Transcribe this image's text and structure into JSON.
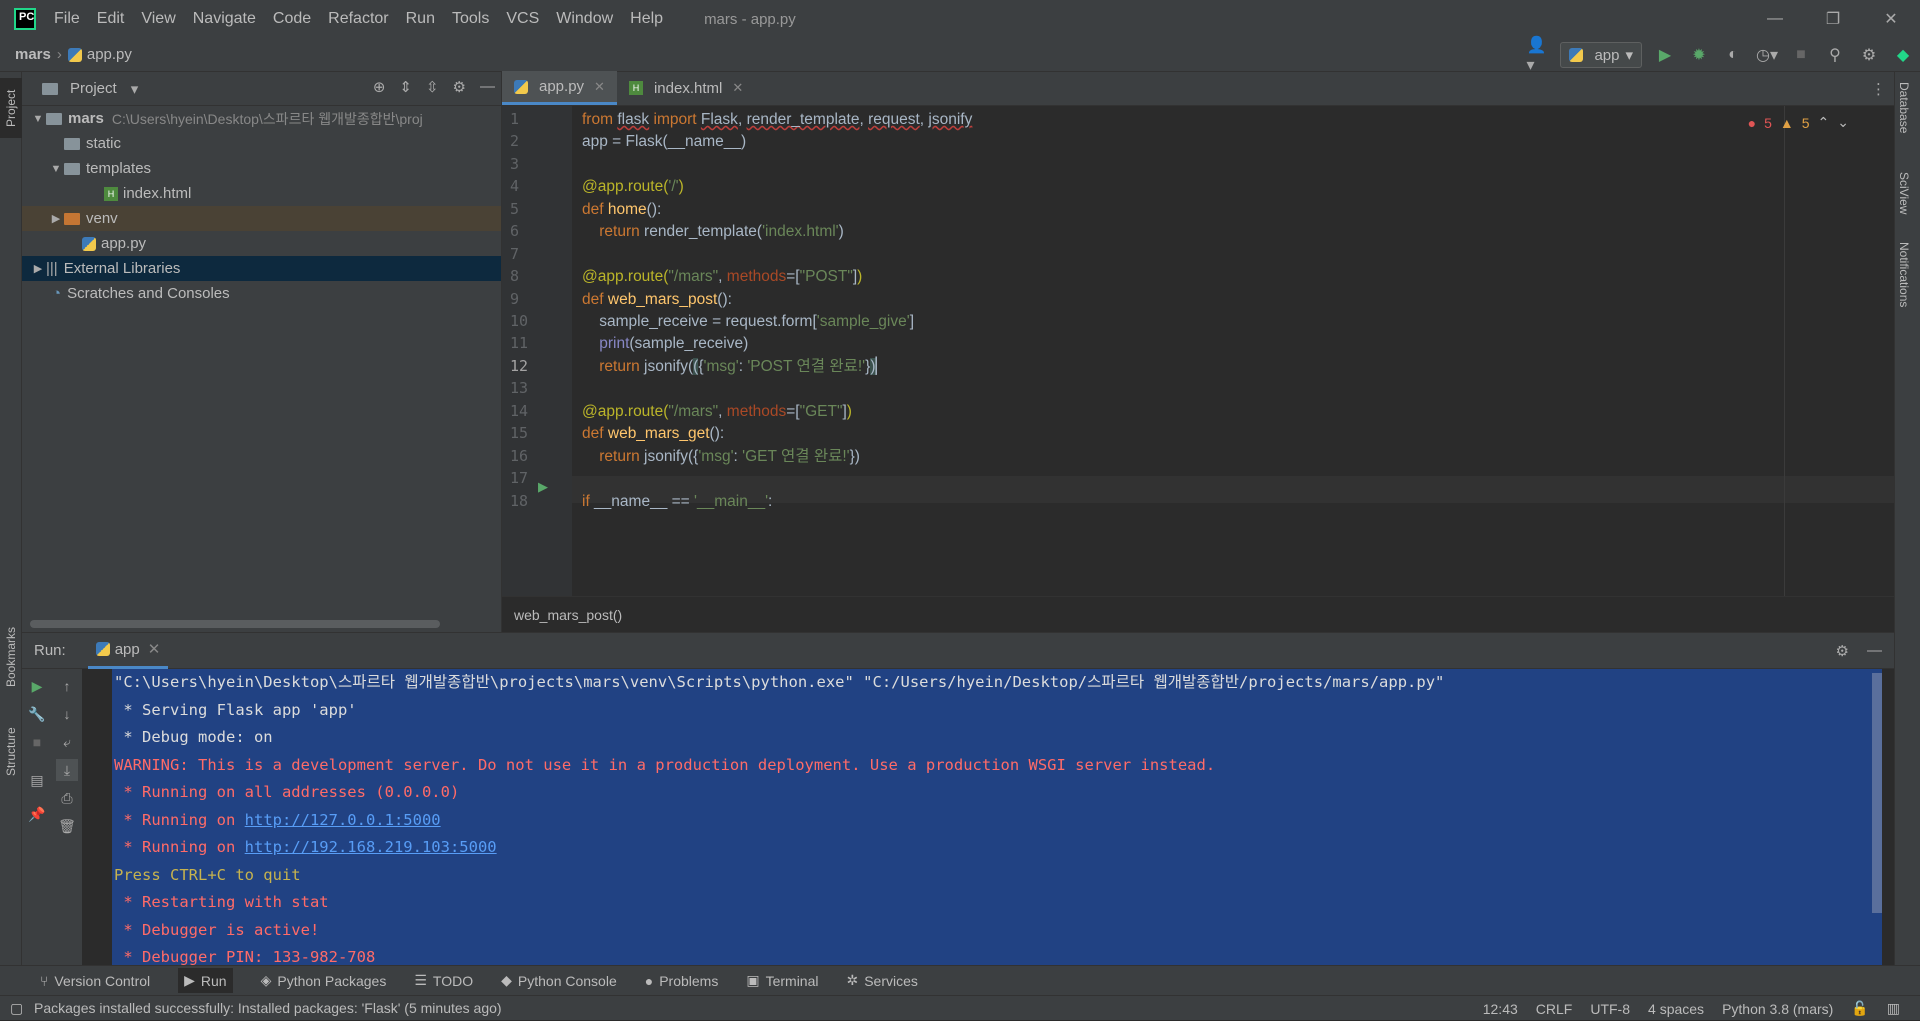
{
  "menu": [
    "File",
    "Edit",
    "View",
    "Navigate",
    "Code",
    "Refactor",
    "Run",
    "Tools",
    "VCS",
    "Window",
    "Help"
  ],
  "window_title": "mars - app.py",
  "breadcrumb": {
    "root": "mars",
    "file": "app.py"
  },
  "run_config": "app",
  "project": {
    "header": "Project",
    "root": "mars",
    "root_path": "C:\\Users\\hyein\\Desktop\\스파르타 웹개발종합반\\proj",
    "items": [
      "static",
      "templates",
      "index.html",
      "venv",
      "app.py",
      "External Libraries",
      "Scratches and Consoles"
    ]
  },
  "tabs": [
    "app.py",
    "index.html"
  ],
  "editor": {
    "error_count": "5",
    "warning_count": "5",
    "breadcrumb": "web_mars_post()"
  },
  "line_numbers": [
    "1",
    "2",
    "3",
    "4",
    "5",
    "6",
    "7",
    "8",
    "9",
    "10",
    "11",
    "12",
    "13",
    "14",
    "15",
    "16",
    "17",
    "18"
  ],
  "run": {
    "label": "Run:",
    "tab": "app"
  },
  "console": [
    "\"C:\\Users\\hyein\\Desktop\\스파르타 웹개발종합반\\projects\\mars\\venv\\Scripts\\python.exe\" \"C:/Users/hyein/Desktop/스파르타 웹개발종합반/projects/mars/app.py\"",
    " * Serving Flask app 'app'",
    " * Debug mode: on",
    "WARNING: This is a development server. Do not use it in a production deployment. Use a production WSGI server instead.",
    " * Running on all addresses (0.0.0.0)",
    " * Running on ",
    "http://127.0.0.1:5000",
    " * Running on ",
    "http://192.168.219.103:5000",
    "Press CTRL+C to quit",
    " * Restarting with stat",
    " * Debugger is active!",
    " * Debugger PIN: 133-982-708"
  ],
  "tool_windows": [
    "Version Control",
    "Run",
    "Python Packages",
    "TODO",
    "Python Console",
    "Problems",
    "Terminal",
    "Services"
  ],
  "left_strip": [
    "Project",
    "Bookmarks",
    "Structure"
  ],
  "right_strip": [
    "Database",
    "SciView",
    "Notifications"
  ],
  "status": {
    "message": "Packages installed successfully: Installed packages: 'Flask' (5 minutes ago)",
    "position": "12:43",
    "line_sep": "CRLF",
    "encoding": "UTF-8",
    "indent": "4 spaces",
    "interpreter": "Python 3.8 (mars)"
  }
}
